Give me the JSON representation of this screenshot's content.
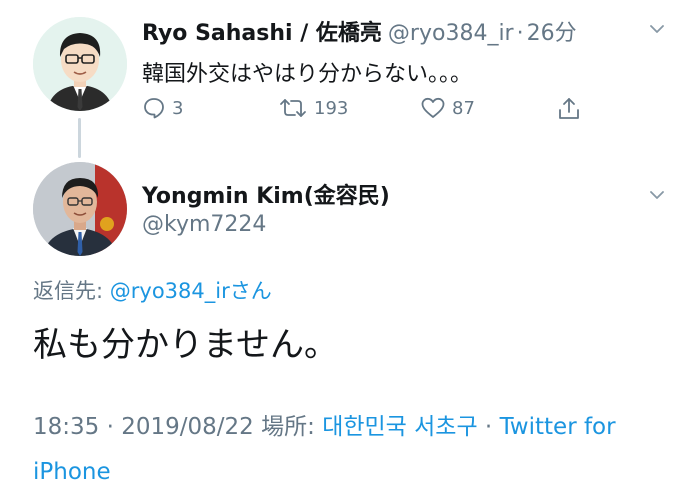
{
  "parent_tweet": {
    "name": "Ryo Sahashi / 佐橋亮",
    "handle": "@ryo384_ir",
    "separator": "·",
    "time": "26分",
    "text": "韓国外交はやはり分からない。。。",
    "actions": {
      "reply_count": "3",
      "retweet_count": "193",
      "like_count": "87"
    }
  },
  "reply_tweet": {
    "name": "Yongmin Kim(金容民)",
    "handle": "@kym7224",
    "replying_prefix": "返信先: ",
    "replying_mention": "@ryo384_irさん",
    "text": "私も分かりません。",
    "meta": {
      "time": "18:35",
      "sep1": " · ",
      "date": "2019/08/22",
      "location_label": " 場所: ",
      "location": "대한민국 서초구",
      "sep2": " · ",
      "source": "Twitter for iPhone"
    }
  },
  "colors": {
    "text": "#14171a",
    "secondary": "#657786",
    "link": "#1b95e0",
    "thread_line": "#ccd6dd"
  }
}
